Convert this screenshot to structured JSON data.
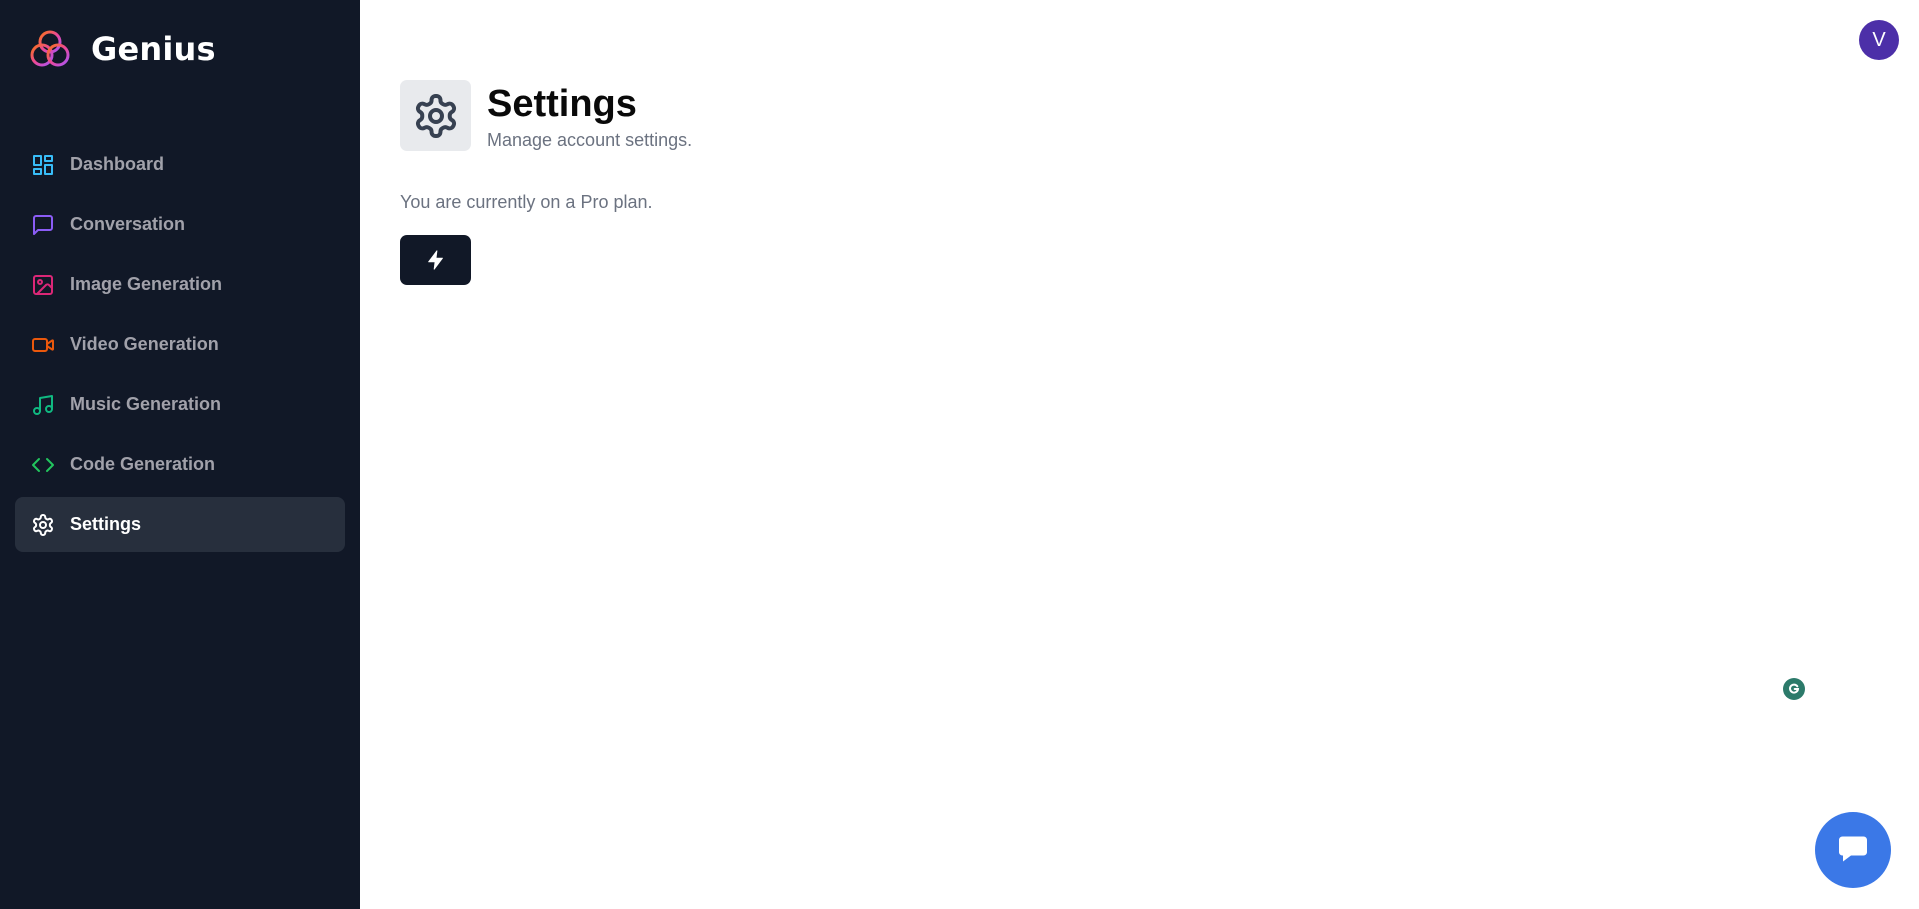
{
  "brand": {
    "name": "Genius"
  },
  "sidebar": {
    "items": [
      {
        "label": "Dashboard",
        "icon": "dashboard-icon",
        "color": "#38bdf8",
        "active": false
      },
      {
        "label": "Conversation",
        "icon": "message-square-icon",
        "color": "#8b5cf6",
        "active": false
      },
      {
        "label": "Image Generation",
        "icon": "image-icon",
        "color": "#db2777",
        "active": false
      },
      {
        "label": "Video Generation",
        "icon": "video-icon",
        "color": "#ea580c",
        "active": false
      },
      {
        "label": "Music Generation",
        "icon": "music-icon",
        "color": "#10b981",
        "active": false
      },
      {
        "label": "Code Generation",
        "icon": "code-icon",
        "color": "#22c55e",
        "active": false
      },
      {
        "label": "Settings",
        "icon": "settings-icon",
        "color": "#ffffff",
        "active": true
      }
    ]
  },
  "user": {
    "avatar_initial": "V",
    "avatar_color": "#4c2fa8"
  },
  "page": {
    "title": "Settings",
    "subtitle": "Manage account settings.",
    "plan_text": "You are currently on a Pro plan."
  },
  "colors": {
    "sidebar_bg": "#111827",
    "active_item_bg": "#272f3d",
    "chat_button": "#3b78e7"
  }
}
